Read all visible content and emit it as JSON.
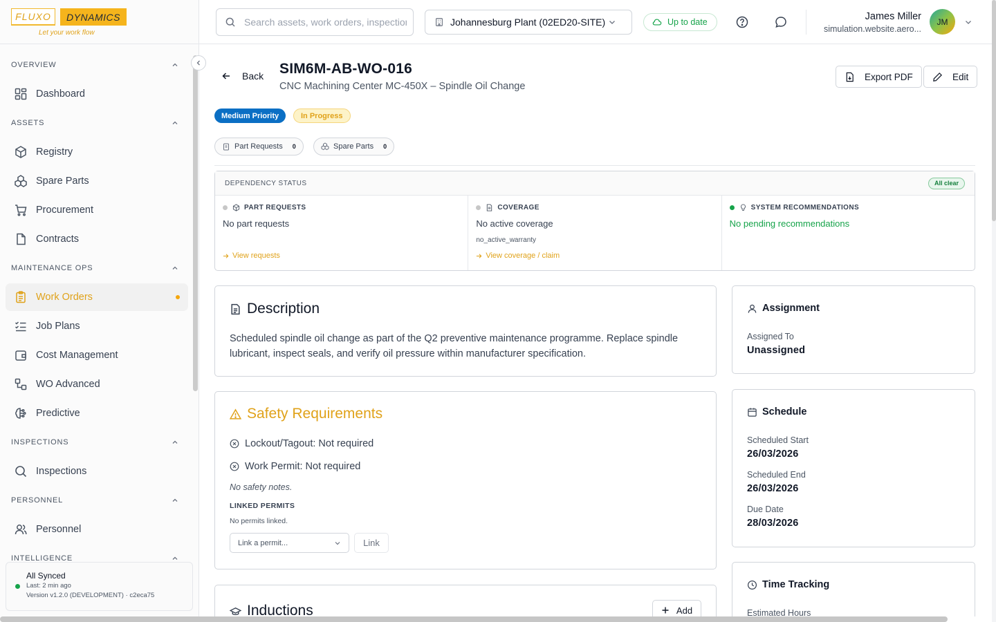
{
  "brand": {
    "left": "FLUXO",
    "right": "DYNAMICS",
    "tagline": "Let your work flow"
  },
  "sidebar": {
    "sections": [
      {
        "label": "OVERVIEW",
        "items": [
          {
            "label": "Dashboard",
            "icon": "dashboard-icon"
          }
        ]
      },
      {
        "label": "ASSETS",
        "items": [
          {
            "label": "Registry",
            "icon": "package-icon"
          },
          {
            "label": "Spare Parts",
            "icon": "boxes-icon"
          },
          {
            "label": "Procurement",
            "icon": "cart-icon"
          },
          {
            "label": "Contracts",
            "icon": "document-icon"
          }
        ]
      },
      {
        "label": "MAINTENANCE OPS",
        "items": [
          {
            "label": "Work Orders",
            "icon": "clipboard-icon",
            "active": true
          },
          {
            "label": "Job Plans",
            "icon": "checklist-icon"
          },
          {
            "label": "Cost Management",
            "icon": "wallet-icon"
          },
          {
            "label": "WO Advanced",
            "icon": "workflow-icon"
          },
          {
            "label": "Predictive",
            "icon": "brain-icon"
          }
        ]
      },
      {
        "label": "INSPECTIONS",
        "items": [
          {
            "label": "Inspections",
            "icon": "search-icon"
          }
        ]
      },
      {
        "label": "PERSONNEL",
        "items": [
          {
            "label": "Personnel",
            "icon": "users-icon"
          }
        ]
      },
      {
        "label": "INTELLIGENCE",
        "items": []
      }
    ],
    "sync": {
      "title": "All Synced",
      "last": "Last: 2 min ago",
      "version": "Version v1.2.0 (DEVELOPMENT) · c2eca75"
    }
  },
  "topbar": {
    "search_placeholder": "Search assets, work orders, inspections...",
    "site": "Johannesburg Plant (02ED20-SITE)",
    "status": "Up to date",
    "user": {
      "name": "James Miller",
      "email": "simulation.website.aero...",
      "initials": "JM"
    }
  },
  "workorder": {
    "back_label": "Back",
    "id": "SIM6M-AB-WO-016",
    "subtitle": "CNC Machining Center MC-450X – Spindle Oil Change",
    "export_label": "Export PDF",
    "edit_label": "Edit",
    "priority": "Medium Priority",
    "status": "In Progress",
    "chips": [
      {
        "label": "Part Requests",
        "count": "0"
      },
      {
        "label": "Spare Parts",
        "count": "0"
      }
    ]
  },
  "dependency": {
    "title": "DEPENDENCY STATUS",
    "badge": "All clear",
    "columns": [
      {
        "label": "PART REQUESTS",
        "value": "No part requests",
        "note": "",
        "link": "View requests"
      },
      {
        "label": "COVERAGE",
        "value": "No active coverage",
        "note": "no_active_warranty",
        "link": "View coverage / claim"
      },
      {
        "label": "SYSTEM RECOMMENDATIONS",
        "value": "No pending recommendations",
        "note": "",
        "link": ""
      }
    ]
  },
  "description": {
    "title": "Description",
    "text": "Scheduled spindle oil change as part of the Q2 preventive maintenance programme. Replace spindle lubricant, inspect seals, and verify oil pressure within manufacturer specification."
  },
  "safety": {
    "title": "Safety Requirements",
    "lockout": "Lockout/Tagout: Not required",
    "permit": "Work Permit: Not required",
    "notes": "No safety notes.",
    "linked_label": "LINKED PERMITS",
    "linked_none": "No permits linked.",
    "select_placeholder": "Link a permit...",
    "link_button": "Link"
  },
  "inductions": {
    "title": "Inductions",
    "add_label": "Add"
  },
  "assignment": {
    "title": "Assignment",
    "key": "Assigned To",
    "value": "Unassigned"
  },
  "schedule": {
    "title": "Schedule",
    "start_key": "Scheduled Start",
    "start": "26/03/2026",
    "end_key": "Scheduled End",
    "end": "26/03/2026",
    "due_key": "Due Date",
    "due": "28/03/2026"
  },
  "time_tracking": {
    "title": "Time Tracking",
    "estimated_key": "Estimated Hours"
  },
  "colors": {
    "accent": "#f5b41c",
    "primary": "#0b6fc4",
    "success": "#16a34a"
  }
}
